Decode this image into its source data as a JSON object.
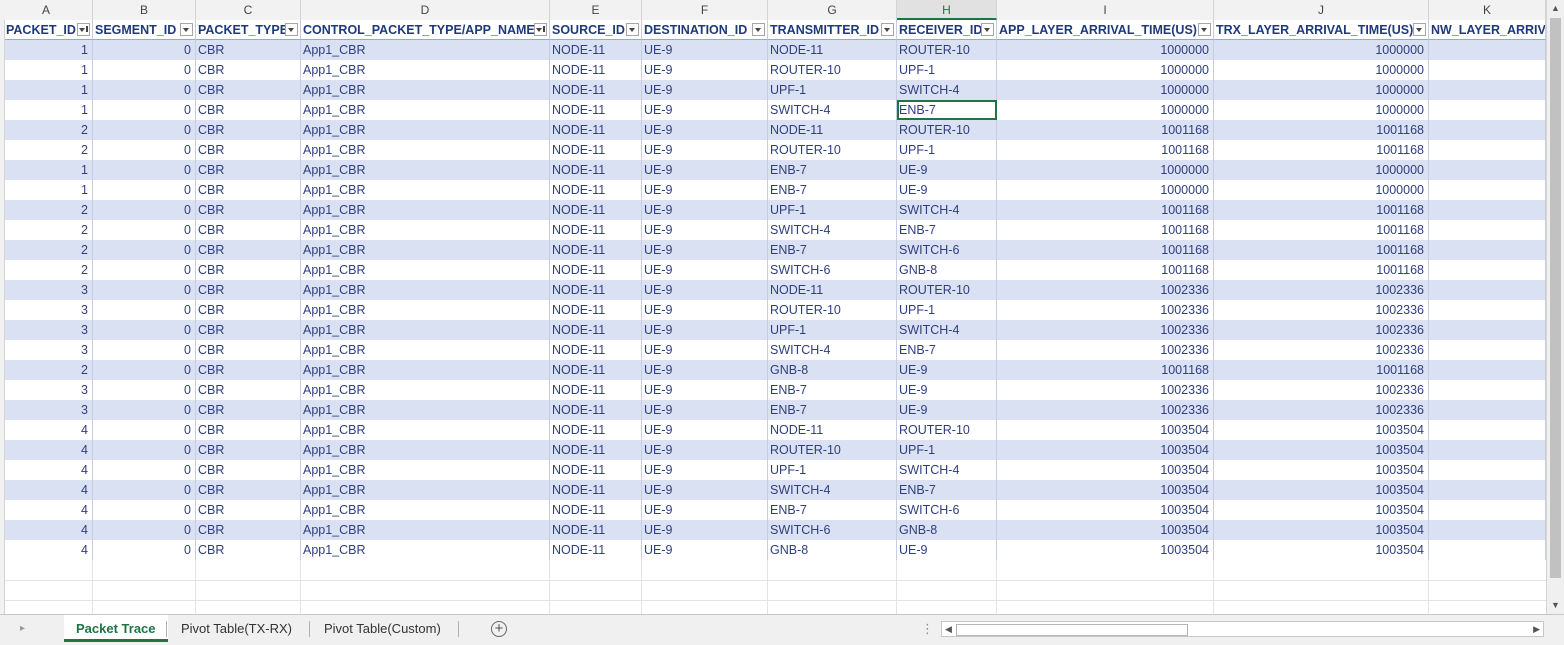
{
  "columns": [
    "A",
    "B",
    "C",
    "D",
    "E",
    "F",
    "G",
    "H",
    "I",
    "J",
    "K"
  ],
  "headers": [
    "PACKET_ID",
    "SEGMENT_ID",
    "PACKET_TYPE",
    "CONTROL_PACKET_TYPE/APP_NAME",
    "SOURCE_ID",
    "DESTINATION_ID",
    "TRANSMITTER_ID",
    "RECEIVER_ID",
    "APP_LAYER_ARRIVAL_TIME(US)",
    "TRX_LAYER_ARRIVAL_TIME(US)",
    "NW_LAYER_ARRIV"
  ],
  "filters_active": [
    true,
    false,
    false,
    true,
    false,
    false,
    false,
    false,
    false,
    false,
    false
  ],
  "selected_column": "H",
  "selected_cell": {
    "row": 3,
    "col": 7
  },
  "rows": [
    [
      "1",
      "0",
      "CBR",
      "App1_CBR",
      "NODE-11",
      "UE-9",
      "NODE-11",
      "ROUTER-10",
      "1000000",
      "1000000"
    ],
    [
      "1",
      "0",
      "CBR",
      "App1_CBR",
      "NODE-11",
      "UE-9",
      "ROUTER-10",
      "UPF-1",
      "1000000",
      "1000000"
    ],
    [
      "1",
      "0",
      "CBR",
      "App1_CBR",
      "NODE-11",
      "UE-9",
      "UPF-1",
      "SWITCH-4",
      "1000000",
      "1000000"
    ],
    [
      "1",
      "0",
      "CBR",
      "App1_CBR",
      "NODE-11",
      "UE-9",
      "SWITCH-4",
      "ENB-7",
      "1000000",
      "1000000"
    ],
    [
      "2",
      "0",
      "CBR",
      "App1_CBR",
      "NODE-11",
      "UE-9",
      "NODE-11",
      "ROUTER-10",
      "1001168",
      "1001168"
    ],
    [
      "2",
      "0",
      "CBR",
      "App1_CBR",
      "NODE-11",
      "UE-9",
      "ROUTER-10",
      "UPF-1",
      "1001168",
      "1001168"
    ],
    [
      "1",
      "0",
      "CBR",
      "App1_CBR",
      "NODE-11",
      "UE-9",
      "ENB-7",
      "UE-9",
      "1000000",
      "1000000"
    ],
    [
      "1",
      "0",
      "CBR",
      "App1_CBR",
      "NODE-11",
      "UE-9",
      "ENB-7",
      "UE-9",
      "1000000",
      "1000000"
    ],
    [
      "2",
      "0",
      "CBR",
      "App1_CBR",
      "NODE-11",
      "UE-9",
      "UPF-1",
      "SWITCH-4",
      "1001168",
      "1001168"
    ],
    [
      "2",
      "0",
      "CBR",
      "App1_CBR",
      "NODE-11",
      "UE-9",
      "SWITCH-4",
      "ENB-7",
      "1001168",
      "1001168"
    ],
    [
      "2",
      "0",
      "CBR",
      "App1_CBR",
      "NODE-11",
      "UE-9",
      "ENB-7",
      "SWITCH-6",
      "1001168",
      "1001168"
    ],
    [
      "2",
      "0",
      "CBR",
      "App1_CBR",
      "NODE-11",
      "UE-9",
      "SWITCH-6",
      "GNB-8",
      "1001168",
      "1001168"
    ],
    [
      "3",
      "0",
      "CBR",
      "App1_CBR",
      "NODE-11",
      "UE-9",
      "NODE-11",
      "ROUTER-10",
      "1002336",
      "1002336"
    ],
    [
      "3",
      "0",
      "CBR",
      "App1_CBR",
      "NODE-11",
      "UE-9",
      "ROUTER-10",
      "UPF-1",
      "1002336",
      "1002336"
    ],
    [
      "3",
      "0",
      "CBR",
      "App1_CBR",
      "NODE-11",
      "UE-9",
      "UPF-1",
      "SWITCH-4",
      "1002336",
      "1002336"
    ],
    [
      "3",
      "0",
      "CBR",
      "App1_CBR",
      "NODE-11",
      "UE-9",
      "SWITCH-4",
      "ENB-7",
      "1002336",
      "1002336"
    ],
    [
      "2",
      "0",
      "CBR",
      "App1_CBR",
      "NODE-11",
      "UE-9",
      "GNB-8",
      "UE-9",
      "1001168",
      "1001168"
    ],
    [
      "3",
      "0",
      "CBR",
      "App1_CBR",
      "NODE-11",
      "UE-9",
      "ENB-7",
      "UE-9",
      "1002336",
      "1002336"
    ],
    [
      "3",
      "0",
      "CBR",
      "App1_CBR",
      "NODE-11",
      "UE-9",
      "ENB-7",
      "UE-9",
      "1002336",
      "1002336"
    ],
    [
      "4",
      "0",
      "CBR",
      "App1_CBR",
      "NODE-11",
      "UE-9",
      "NODE-11",
      "ROUTER-10",
      "1003504",
      "1003504"
    ],
    [
      "4",
      "0",
      "CBR",
      "App1_CBR",
      "NODE-11",
      "UE-9",
      "ROUTER-10",
      "UPF-1",
      "1003504",
      "1003504"
    ],
    [
      "4",
      "0",
      "CBR",
      "App1_CBR",
      "NODE-11",
      "UE-9",
      "UPF-1",
      "SWITCH-4",
      "1003504",
      "1003504"
    ],
    [
      "4",
      "0",
      "CBR",
      "App1_CBR",
      "NODE-11",
      "UE-9",
      "SWITCH-4",
      "ENB-7",
      "1003504",
      "1003504"
    ],
    [
      "4",
      "0",
      "CBR",
      "App1_CBR",
      "NODE-11",
      "UE-9",
      "ENB-7",
      "SWITCH-6",
      "1003504",
      "1003504"
    ],
    [
      "4",
      "0",
      "CBR",
      "App1_CBR",
      "NODE-11",
      "UE-9",
      "SWITCH-6",
      "GNB-8",
      "1003504",
      "1003504"
    ],
    [
      "4",
      "0",
      "CBR",
      "App1_CBR",
      "NODE-11",
      "UE-9",
      "GNB-8",
      "UE-9",
      "1003504",
      "1003504"
    ]
  ],
  "numeric_columns": [
    0,
    1,
    8,
    9
  ],
  "sheet_tabs": [
    "Packet Trace",
    "Pivot Table(TX-RX)",
    "Pivot Table(Custom)"
  ],
  "active_tab": 0,
  "colors": {
    "band": "#d9e1f2",
    "accent": "#217346",
    "text": "#2f3f7f"
  },
  "icons": {
    "add_sheet": "plus-circle-icon",
    "filter": "filter-dropdown-icon"
  }
}
